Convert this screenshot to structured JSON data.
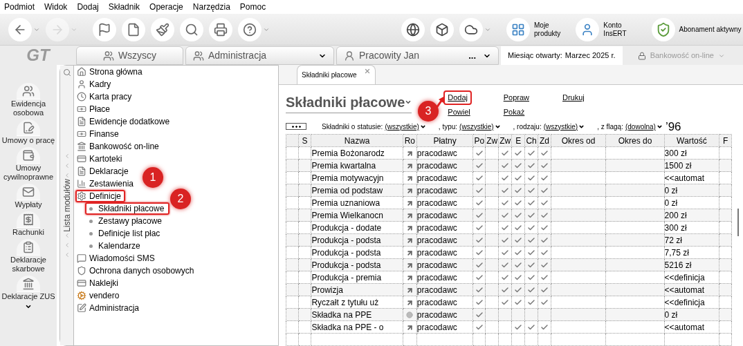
{
  "menu_bar": [
    "Podmiot",
    "Widok",
    "Dodaj",
    "Składnik",
    "Operacje",
    "Narzędzia",
    "Pomoc"
  ],
  "toolbar": {
    "tools": [
      {
        "kind": "back",
        "dropdown": true,
        "disabled": false
      },
      {
        "kind": "forward",
        "dropdown": true,
        "disabled": true
      },
      {
        "kind": "flag",
        "dropdown": false,
        "disabled": false
      },
      {
        "kind": "file",
        "dropdown": false,
        "disabled": false
      },
      {
        "kind": "brush",
        "dropdown": false,
        "disabled": false
      },
      {
        "kind": "search",
        "dropdown": false,
        "disabled": false
      },
      {
        "kind": "printer",
        "dropdown": false,
        "disabled": false
      },
      {
        "kind": "help",
        "dropdown": true,
        "disabled": false
      }
    ],
    "services": [
      {
        "kind": "globe",
        "dropdown": false
      },
      {
        "kind": "box",
        "dropdown": false
      },
      {
        "kind": "cloud",
        "dropdown": true
      }
    ],
    "links": [
      {
        "kind": "products",
        "lines": [
          "Moje",
          "produkty"
        ]
      },
      {
        "kind": "account",
        "lines": [
          "Konto",
          "InsERT"
        ]
      }
    ],
    "subscription": "Abonament aktywny"
  },
  "context_bar": {
    "logo": "GT",
    "groups": [
      {
        "kind": "all",
        "label": "Wszyscy",
        "menu": false
      },
      {
        "kind": "group",
        "label": "Administracja",
        "menu": true
      },
      {
        "kind": "person",
        "label": "Pracowity Jan",
        "extra": "...",
        "menu": true
      }
    ],
    "month_label": "Miesiąc otwarty:",
    "month_value": "Marzec 2025 r.",
    "banking": {
      "label": "Bankowość on-line",
      "disabled": true
    }
  },
  "quick_nav": [
    {
      "kind": "people",
      "lines": [
        "Ewidencja",
        "osobowa"
      ]
    },
    {
      "kind": "contract",
      "lines": [
        "Umowy o pracę"
      ]
    },
    {
      "kind": "civil",
      "lines": [
        "Umowy",
        "cywilnoprawne"
      ]
    },
    {
      "kind": "payout",
      "lines": [
        "Wypłaty"
      ]
    },
    {
      "kind": "bill",
      "lines": [
        "Rachunki"
      ]
    },
    {
      "kind": "tax",
      "lines": [
        "Deklaracje",
        "skarbowe"
      ]
    },
    {
      "kind": "zus",
      "lines": [
        "Deklaracje ZUS"
      ]
    }
  ],
  "module_list": {
    "title": "Lista modułów",
    "items": [
      {
        "kind": "home",
        "label": "Strona główna",
        "annotated": false
      },
      {
        "kind": "person",
        "label": "Kadry",
        "annotated": false
      },
      {
        "kind": "clock",
        "label": "Karta pracy",
        "annotated": false
      },
      {
        "kind": "money",
        "label": "Płace",
        "annotated": false
      },
      {
        "kind": "doc",
        "label": "Ewidencje dodatkowe",
        "annotated": false
      },
      {
        "kind": "money",
        "label": "Finanse",
        "annotated": false
      },
      {
        "kind": "bank",
        "label": "Bankowość on-line",
        "annotated": false
      },
      {
        "kind": "cards",
        "label": "Kartoteki",
        "annotated": false
      },
      {
        "kind": "doc",
        "label": "Deklaracje",
        "annotated": false
      },
      {
        "kind": "chart",
        "label": "Zestawienia",
        "annotated": false
      },
      {
        "kind": "definitions",
        "label": "Definicje",
        "annotated": true,
        "children": [
          {
            "label": "Składniki płacowe",
            "annotated": true
          },
          {
            "label": "Zestawy płacowe",
            "annotated": false
          },
          {
            "label": "Definicje list płac",
            "annotated": false
          },
          {
            "label": "Kalendarze",
            "annotated": false
          }
        ]
      },
      {
        "kind": "sms",
        "label": "Wiadomości SMS",
        "annotated": false
      },
      {
        "kind": "shield",
        "label": "Ochrona danych osobowych",
        "annotated": false
      },
      {
        "kind": "cards",
        "label": "Naklejki",
        "annotated": false
      },
      {
        "kind": "gear",
        "label": "vendero",
        "annotated": false
      },
      {
        "kind": "edit",
        "label": "Administracja",
        "annotated": false
      }
    ]
  },
  "document_tab": {
    "label": "Składniki płacowe",
    "closable": true
  },
  "page_title": "Składniki płacowe",
  "actions": [
    [
      {
        "label": "Dodaj",
        "annotated": true
      },
      {
        "label": "Powiel",
        "annotated": false
      }
    ],
    [
      {
        "label": "Popraw",
        "annotated": false
      },
      {
        "label": "Pokaż",
        "annotated": false
      }
    ],
    [
      {
        "label": "Drukuj",
        "annotated": false
      }
    ]
  ],
  "filters": [
    {
      "label": "Składniki o statusie:",
      "value": "(wszystkie)"
    },
    {
      "label": ", typu:",
      "value": "(wszystkie)"
    },
    {
      "label": ", rodzaju:",
      "value": "(wszystkie)"
    },
    {
      "label": ", z flagą:",
      "value": "(dowolna)"
    }
  ],
  "filter_counter": "’96",
  "table": {
    "columns": [
      "S",
      "Nazwa",
      "Ro",
      "Płatny",
      "Po",
      "Zw",
      "Zw",
      "E",
      "Ch",
      "Zd",
      "Okres od",
      "Okres do",
      "Wartość",
      "F"
    ],
    "rows": [
      {
        "name": "Premia Bożonarodz",
        "kind": "arrow",
        "payer": "pracodawc",
        "checks": [
          true,
          false,
          true,
          true,
          true,
          true
        ],
        "value": "300 zł"
      },
      {
        "name": "Premia kwartalna",
        "kind": "arrow",
        "payer": "pracodawc",
        "checks": [
          true,
          false,
          true,
          true,
          true,
          true
        ],
        "value": "1500 zł"
      },
      {
        "name": "Premia motywacyjn",
        "kind": "arrow",
        "payer": "pracodawc",
        "checks": [
          true,
          false,
          true,
          true,
          true,
          true
        ],
        "value": "<<automat"
      },
      {
        "name": "Premia od podstaw",
        "kind": "arrow",
        "payer": "pracodawc",
        "checks": [
          true,
          false,
          true,
          true,
          true,
          true
        ],
        "value": "0 zł"
      },
      {
        "name": "Premia uznaniowa",
        "kind": "arrow",
        "payer": "pracodawc",
        "checks": [
          true,
          false,
          true,
          true,
          true,
          true
        ],
        "value": "0 zł"
      },
      {
        "name": "Premia Wielkanocn",
        "kind": "arrow",
        "payer": "pracodawc",
        "checks": [
          true,
          false,
          true,
          true,
          true,
          true
        ],
        "value": "200 zł"
      },
      {
        "name": "Produkcja - dodate",
        "kind": "arrow",
        "payer": "pracodawc",
        "checks": [
          true,
          false,
          true,
          true,
          true,
          true
        ],
        "value": "300 zł"
      },
      {
        "name": "Produkcja - podsta",
        "kind": "arrow",
        "payer": "pracodawc",
        "checks": [
          true,
          false,
          true,
          true,
          true,
          true
        ],
        "value": "72 zł"
      },
      {
        "name": "Produkcja - podsta",
        "kind": "arrow",
        "payer": "pracodawc",
        "checks": [
          true,
          false,
          true,
          true,
          true,
          true
        ],
        "value": "7,75 zł"
      },
      {
        "name": "Produkcja - podsta",
        "kind": "arrow",
        "payer": "pracodawc",
        "checks": [
          true,
          false,
          true,
          true,
          true,
          true
        ],
        "value": "5216 zł"
      },
      {
        "name": "Produkcja - premia",
        "kind": "arrow",
        "payer": "pracodawc",
        "checks": [
          true,
          false,
          true,
          true,
          true,
          true
        ],
        "value": "<<definicja"
      },
      {
        "name": "Prowizja",
        "kind": "arrow",
        "payer": "pracodawc",
        "checks": [
          true,
          false,
          true,
          true,
          true,
          true
        ],
        "value": "<<automat"
      },
      {
        "name": "Ryczałt z tytułu uż",
        "kind": "arrow",
        "payer": "pracodawc",
        "checks": [
          true,
          false,
          true,
          true,
          true,
          true
        ],
        "value": "<<definicja"
      },
      {
        "name": "Składka na PPE",
        "kind": "coin",
        "payer": "pracodawc",
        "checks": [
          true,
          false,
          false,
          false,
          false,
          false
        ],
        "value": "0 zł"
      },
      {
        "name": "Składka na PPE - o",
        "kind": "arrow",
        "payer": "pracodawc",
        "checks": [
          true,
          false,
          false,
          true,
          true,
          true
        ],
        "value": "<<automat"
      }
    ]
  },
  "annotations": [
    {
      "kind": "badge",
      "label": "1"
    },
    {
      "kind": "badge",
      "label": "2"
    },
    {
      "kind": "badge",
      "label": "3"
    },
    {
      "kind": "arrow"
    }
  ]
}
